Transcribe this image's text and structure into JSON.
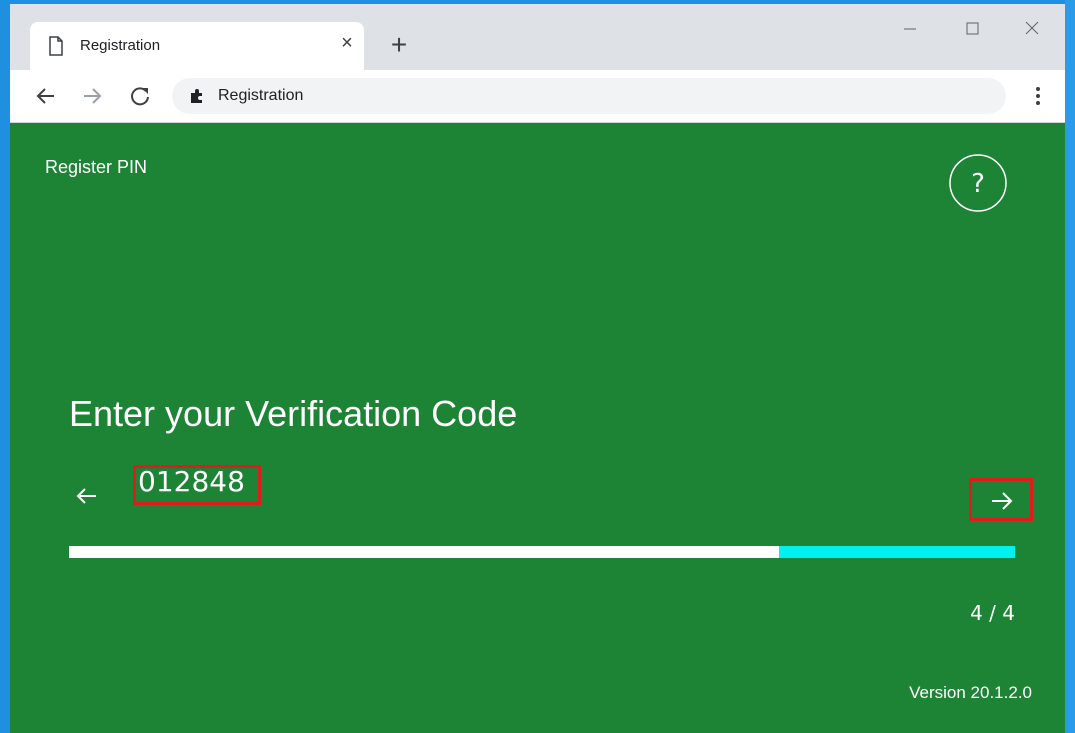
{
  "browser": {
    "tab_title": "Registration",
    "close_glyph": "×",
    "new_tab_glyph": "+",
    "address_text": "Registration",
    "icons": {
      "tab": "page-icon",
      "address": "puzzle-extension-icon",
      "back": "arrow-left-icon",
      "forward": "arrow-right-icon",
      "reload": "reload-icon",
      "menu": "kebab-menu-icon",
      "minimize": "minimize-icon",
      "maximize": "maximize-icon",
      "close": "close-icon"
    }
  },
  "app": {
    "header": "Register PIN",
    "help_glyph": "?",
    "heading": "Enter your Verification Code",
    "code_value": "012848",
    "progress_fraction": 0.75,
    "step_current": "4",
    "step_separator": "/",
    "step_total": "4",
    "version": "Version 20.1.2.0",
    "colors": {
      "background": "#1d8436",
      "progress_done": "#ffffff",
      "progress_remaining": "#00f0f0",
      "highlight": "#e01b1b"
    }
  }
}
